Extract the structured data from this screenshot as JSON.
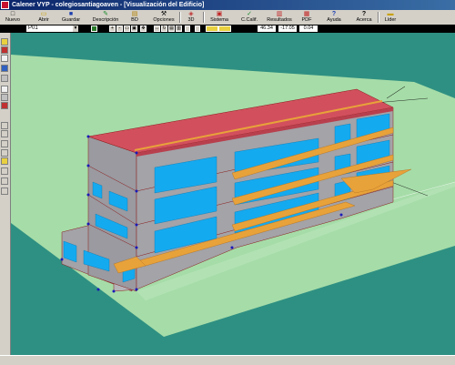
{
  "window": {
    "title": "Calener VYP - colegiosantiagoaven - [Visualización del Edificio]"
  },
  "toolbar": {
    "buttons": [
      {
        "label": "Nuevo",
        "icon": "new-file-icon",
        "glyph": "□"
      },
      {
        "label": "Abrir",
        "icon": "open-folder-icon",
        "glyph": "▭"
      },
      {
        "label": "Guardar",
        "icon": "save-disk-icon",
        "glyph": "■"
      },
      {
        "label": "Descripción",
        "icon": "description-icon",
        "glyph": "✎"
      },
      {
        "label": "BD",
        "icon": "database-icon",
        "glyph": "▤"
      },
      {
        "label": "Opciones",
        "icon": "options-icon",
        "glyph": "⚒"
      },
      {
        "label": "3D",
        "icon": "3d-view-icon",
        "glyph": "◈"
      },
      {
        "label": "Sistema",
        "icon": "system-icon",
        "glyph": "▣"
      },
      {
        "label": "C.Calif.",
        "icon": "qualify-icon",
        "glyph": "✓"
      },
      {
        "label": "Resultados",
        "icon": "results-icon",
        "glyph": "▥"
      },
      {
        "label": "PDF",
        "icon": "pdf-icon",
        "glyph": "▦"
      },
      {
        "label": "Ayuda",
        "icon": "help-icon",
        "glyph": "?"
      },
      {
        "label": "Acerca",
        "icon": "about-icon",
        "glyph": "?"
      },
      {
        "label": "Líder",
        "icon": "lider-icon",
        "glyph": "▬"
      }
    ]
  },
  "options_bar": {
    "floor_value": "P01",
    "coord_x": "46.34",
    "coord_y": "-17.05",
    "coord_z": "0.04"
  },
  "viewport": {
    "background_color": "#2e9082",
    "ground_color": "#a6dca8",
    "roof_color": "#d2505e",
    "wall_color": "#a3a3a8",
    "window_color": "#14aaf0",
    "slab_color": "#e8a23a",
    "vertex_color": "#1a1ab8"
  },
  "statusbar": {
    "text": ""
  }
}
